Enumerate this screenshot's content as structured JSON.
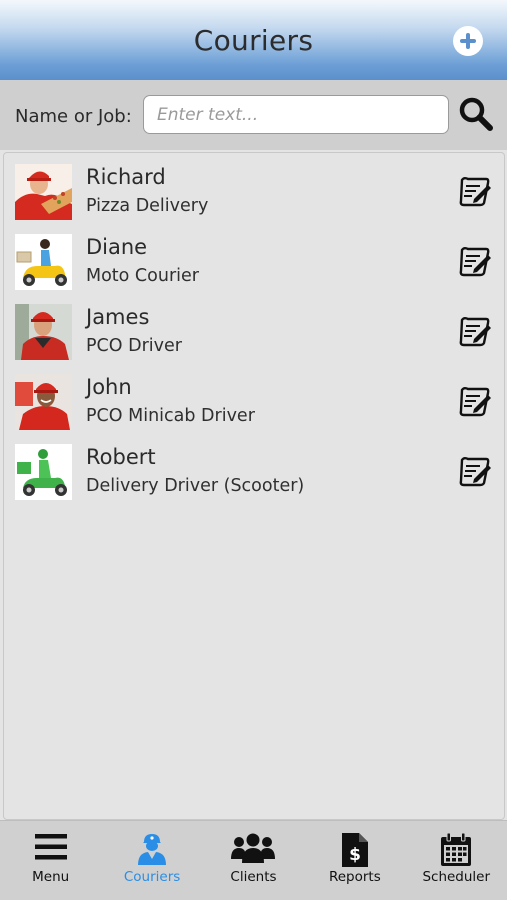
{
  "header": {
    "title": "Couriers",
    "add_label": "+"
  },
  "search": {
    "label": "Name or Job:",
    "placeholder": "Enter text...",
    "value": ""
  },
  "couriers": [
    {
      "name": "Richard",
      "job": "Pizza Delivery",
      "avatar": "pizza-delivery-person-avatar"
    },
    {
      "name": "Diane",
      "job": "Moto Courier",
      "avatar": "moto-courier-avatar"
    },
    {
      "name": "James",
      "job": "PCO Driver",
      "avatar": "driver-avatar"
    },
    {
      "name": "John",
      "job": "PCO Minicab Driver",
      "avatar": "minicab-driver-avatar"
    },
    {
      "name": "Robert",
      "job": "Delivery Driver (Scooter)",
      "avatar": "scooter-driver-avatar"
    }
  ],
  "tabs": [
    {
      "label": "Menu",
      "icon": "hamburger-menu-icon",
      "active": false
    },
    {
      "label": "Couriers",
      "icon": "courier-person-icon",
      "active": true
    },
    {
      "label": "Clients",
      "icon": "group-people-icon",
      "active": false
    },
    {
      "label": "Reports",
      "icon": "dollar-document-icon",
      "active": false
    },
    {
      "label": "Scheduler",
      "icon": "calendar-icon",
      "active": false
    }
  ],
  "colors": {
    "accent": "#2a8ee6",
    "header_blue": "#5b90cc",
    "background": "#e4e4e4",
    "tabbar": "#d0d0d0"
  }
}
